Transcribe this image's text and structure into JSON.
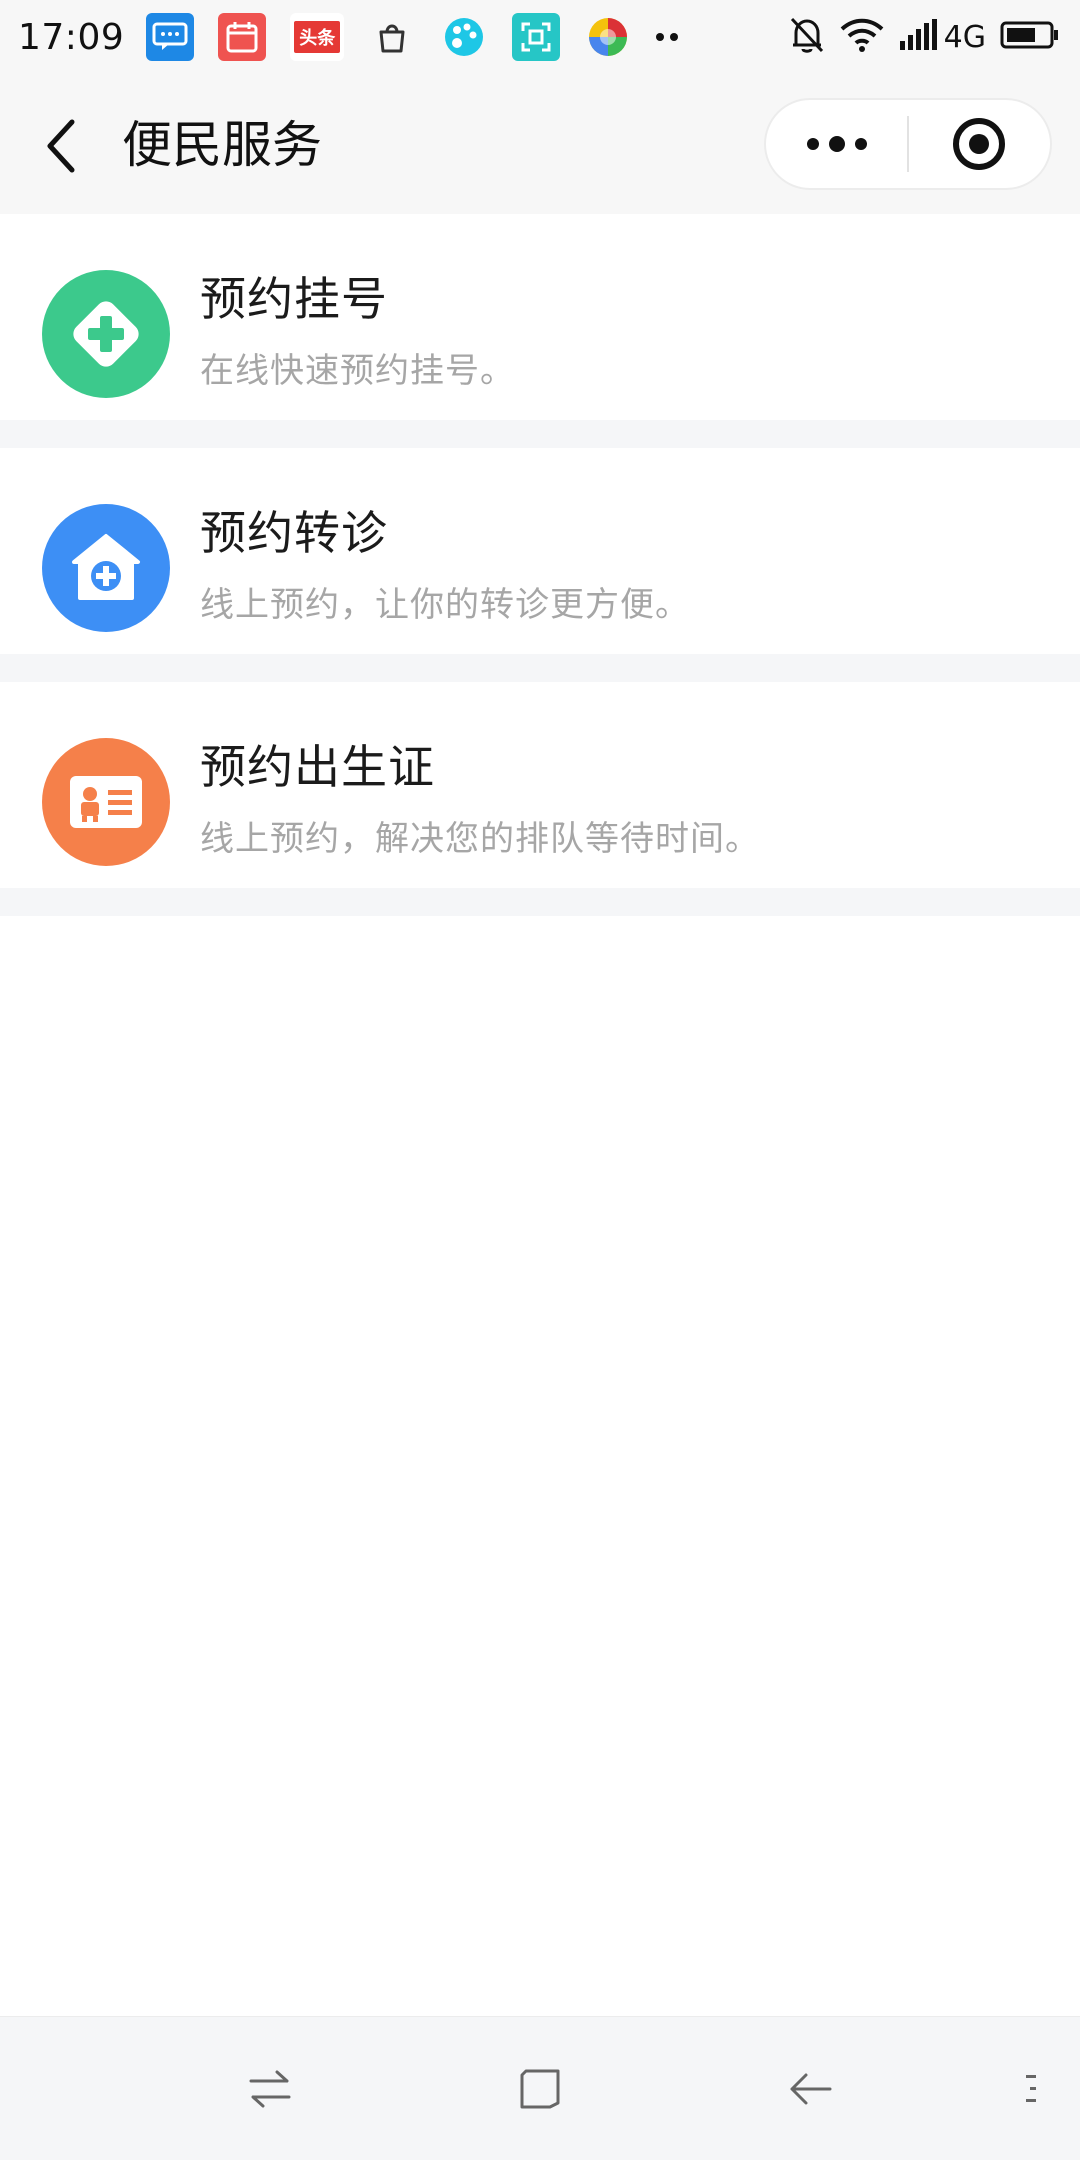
{
  "status_bar": {
    "time": "17:09",
    "network": "4G",
    "apps": [
      {
        "icon": "message-icon",
        "color": "#1e88e5"
      },
      {
        "icon": "calendar-icon",
        "color": "#ef5350"
      },
      {
        "icon": "toutiao-icon",
        "color": "#e53935",
        "label": "头条"
      },
      {
        "icon": "shopping-bag-icon",
        "color": "#333333"
      },
      {
        "icon": "palette-icon",
        "color": "#1ec7e6"
      },
      {
        "icon": "scan-icon",
        "color": "#26c6c6"
      },
      {
        "icon": "color-ball-icon",
        "color": "#7cb342"
      }
    ],
    "indicators": [
      "bell-off-icon",
      "wifi-icon",
      "signal-icon",
      "battery-icon"
    ]
  },
  "header": {
    "title": "便民服务",
    "back_icon": "chevron-left-icon",
    "capsule": {
      "more_icon": "more-dots-icon",
      "close_icon": "target-icon"
    }
  },
  "services": [
    {
      "title": "预约挂号",
      "description": "在线快速预约挂号。",
      "icon": "plus-diamond-icon",
      "color": "#3cc98c"
    },
    {
      "title": "预约转诊",
      "description": "线上预约，让你的转诊更方便。",
      "icon": "house-plus-icon",
      "color": "#3d8ff5"
    },
    {
      "title": "预约出生证",
      "description": "线上预约，解决您的排队等待时间。",
      "icon": "id-card-icon",
      "color": "#f5804a"
    }
  ],
  "navigation": {
    "buttons": [
      "switch-icon",
      "home-square-icon",
      "back-arrow-icon",
      "menu-icon"
    ]
  }
}
